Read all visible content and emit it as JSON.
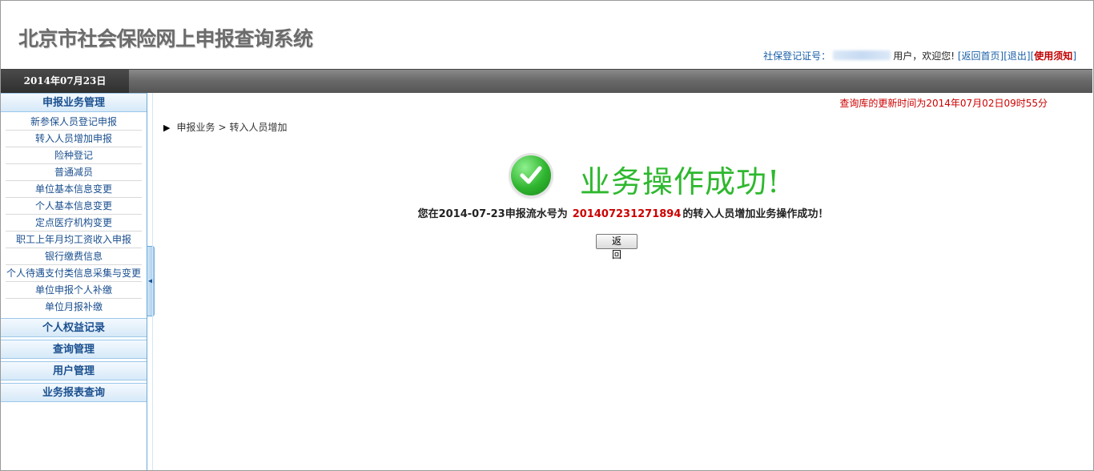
{
  "header": {
    "title": "北京市社会保险网上申报查询系统",
    "user_bar": {
      "reg_label": "社保登记证号：",
      "user_welcome": "用户，欢迎您!",
      "home_link": "返回首页",
      "logout_link": "退出",
      "notice_link": "使用须知",
      "bracket_open": "[",
      "bracket_close": "]"
    }
  },
  "date_bar": {
    "date": "2014年07月23日"
  },
  "sidebar": {
    "sections": [
      {
        "title": "申报业务管理",
        "items": [
          "新参保人员登记申报",
          "转入人员增加申报",
          "险种登记",
          "普通减员",
          "单位基本信息变更",
          "个人基本信息变更",
          "定点医疗机构变更",
          "职工上年月均工资收入申报",
          "银行缴费信息",
          "个人待遇支付类信息采集与变更",
          "单位申报个人补缴",
          "单位月报补缴"
        ]
      },
      {
        "title": "个人权益记录"
      },
      {
        "title": "查询管理"
      },
      {
        "title": "用户管理"
      },
      {
        "title": "业务报表查询"
      }
    ]
  },
  "main": {
    "update_time": "查询库的更新时间为2014年07月02日09时55分",
    "breadcrumb": {
      "root": "申报业务",
      "separator": ">",
      "current": "转入人员增加"
    },
    "success_title": "业务操作成功!",
    "detail_prefix": "您在2014-07-23申报流水号为",
    "serial_number": "201407231271894",
    "detail_suffix": "的转入人员增加业务操作成功！",
    "back_button": "返 回"
  },
  "colors": {
    "accent": "#1a5fa8",
    "success": "#2eb82e",
    "alert": "#cc0000"
  }
}
